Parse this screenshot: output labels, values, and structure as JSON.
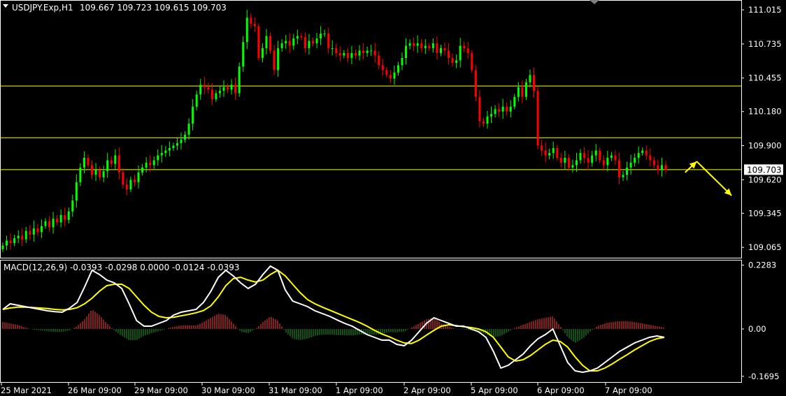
{
  "chart_data": {
    "type": "candlestick",
    "symbol_header": "USDJPY.Exp,H1",
    "ohlc_header": "109.667 109.723 109.615 109.703",
    "last_price": "109.703",
    "price_ticks": [
      "111.015",
      "110.735",
      "110.455",
      "110.180",
      "109.900",
      "109.620",
      "109.345",
      "109.065"
    ],
    "price_range": [
      108.98,
      111.09
    ],
    "horizontal_levels": [
      110.39,
      109.965,
      109.703
    ],
    "time_labels": [
      "25 Mar 2021",
      "26 Mar 09:00",
      "29 Mar 09:00",
      "30 Mar 09:00",
      "31 Mar 09:00",
      "1 Apr 09:00",
      "2 Apr 09:00",
      "5 Apr 09:00",
      "6 Apr 09:00",
      "7 Apr 09:00"
    ],
    "closes": [
      109.08,
      109.12,
      109.1,
      109.14,
      109.16,
      109.13,
      109.2,
      109.17,
      109.22,
      109.19,
      109.24,
      109.28,
      109.23,
      109.3,
      109.27,
      109.33,
      109.29,
      109.36,
      109.45,
      109.6,
      109.72,
      109.8,
      109.74,
      109.66,
      109.7,
      109.64,
      109.69,
      109.78,
      109.75,
      109.82,
      109.68,
      109.58,
      109.54,
      109.62,
      109.6,
      109.68,
      109.72,
      109.76,
      109.74,
      109.78,
      109.82,
      109.84,
      109.86,
      109.88,
      109.9,
      109.92,
      109.95,
      109.99,
      110.08,
      110.22,
      110.32,
      110.4,
      110.38,
      110.36,
      110.28,
      110.33,
      110.35,
      110.38,
      110.36,
      110.4,
      110.33,
      110.55,
      110.75,
      110.95,
      110.9,
      110.88,
      110.62,
      110.7,
      110.8,
      110.68,
      110.52,
      110.7,
      110.74,
      110.76,
      110.72,
      110.78,
      110.8,
      110.79,
      110.7,
      110.76,
      110.74,
      110.78,
      110.82,
      110.82,
      110.7,
      110.7,
      110.66,
      110.64,
      110.66,
      110.62,
      110.66,
      110.64,
      110.68,
      110.66,
      110.68,
      110.68,
      110.64,
      110.56,
      110.52,
      110.48,
      110.45,
      110.5,
      110.56,
      110.62,
      110.72,
      110.74,
      110.72,
      110.74,
      110.7,
      110.72,
      110.7,
      110.74,
      110.66,
      110.7,
      110.68,
      110.62,
      110.58,
      110.6,
      110.72,
      110.7,
      110.66,
      110.52,
      110.3,
      110.1,
      110.08,
      110.14,
      110.16,
      110.2,
      110.18,
      110.22,
      110.18,
      110.22,
      110.3,
      110.38,
      110.3,
      110.42,
      110.48,
      110.35,
      109.9,
      109.86,
      109.82,
      109.84,
      109.88,
      109.8,
      109.76,
      109.8,
      109.72,
      109.74,
      109.78,
      109.84,
      109.8,
      109.76,
      109.82,
      109.86,
      109.78,
      109.74,
      109.8,
      109.82,
      109.78,
      109.64,
      109.66,
      109.72,
      109.76,
      109.8,
      109.84,
      109.86,
      109.82,
      109.78,
      109.74,
      109.7,
      109.74,
      109.7
    ],
    "macd_label": "MACD(12,26,9) -0.0393 -0.0298 0.0000 -0.0124 -0.0393",
    "macd_ticks": [
      "0.2283",
      "0.00",
      "-0.1695"
    ],
    "macd_range": [
      -0.19,
      0.245
    ],
    "macd_line": [
      0.07,
      0.09,
      0.085,
      0.08,
      0.075,
      0.07,
      0.065,
      0.062,
      0.06,
      0.075,
      0.095,
      0.15,
      0.21,
      0.195,
      0.175,
      0.165,
      0.145,
      0.09,
      0.03,
      0.01,
      0.01,
      0.02,
      0.03,
      0.05,
      0.06,
      0.065,
      0.07,
      0.095,
      0.135,
      0.185,
      0.21,
      0.19,
      0.165,
      0.145,
      0.16,
      0.195,
      0.225,
      0.21,
      0.14,
      0.1,
      0.09,
      0.08,
      0.065,
      0.055,
      0.045,
      0.032,
      0.02,
      0.01,
      -0.005,
      -0.02,
      -0.03,
      -0.04,
      -0.04,
      -0.055,
      -0.06,
      -0.04,
      -0.01,
      0.02,
      0.04,
      0.03,
      0.02,
      0.01,
      0.01,
      0.0,
      -0.01,
      -0.03,
      -0.08,
      -0.14,
      -0.13,
      -0.11,
      -0.09,
      -0.06,
      -0.035,
      -0.02,
      0.0,
      -0.06,
      -0.12,
      -0.15,
      -0.155,
      -0.15,
      -0.14,
      -0.12,
      -0.1,
      -0.08,
      -0.065,
      -0.05,
      -0.04,
      -0.03,
      -0.025,
      -0.03
    ],
    "signal_line": [
      0.07,
      0.075,
      0.078,
      0.078,
      0.077,
      0.075,
      0.073,
      0.07,
      0.068,
      0.07,
      0.076,
      0.09,
      0.11,
      0.135,
      0.155,
      0.16,
      0.16,
      0.145,
      0.115,
      0.085,
      0.06,
      0.045,
      0.04,
      0.042,
      0.047,
      0.052,
      0.058,
      0.066,
      0.083,
      0.115,
      0.155,
      0.18,
      0.185,
      0.175,
      0.168,
      0.175,
      0.195,
      0.21,
      0.19,
      0.16,
      0.13,
      0.105,
      0.09,
      0.078,
      0.067,
      0.056,
      0.045,
      0.034,
      0.023,
      0.01,
      -0.005,
      -0.018,
      -0.028,
      -0.04,
      -0.05,
      -0.052,
      -0.04,
      -0.022,
      -0.005,
      0.01,
      0.015,
      0.012,
      0.008,
      0.005,
      0.0,
      -0.01,
      -0.03,
      -0.065,
      -0.1,
      -0.115,
      -0.11,
      -0.095,
      -0.075,
      -0.055,
      -0.04,
      -0.045,
      -0.065,
      -0.1,
      -0.13,
      -0.15,
      -0.15,
      -0.14,
      -0.125,
      -0.108,
      -0.092,
      -0.075,
      -0.06,
      -0.045,
      -0.035,
      -0.03
    ],
    "histogram": [
      0.025,
      0.02,
      0.015,
      0.005,
      -0.002,
      -0.005,
      -0.008,
      -0.01,
      -0.01,
      -0.005,
      0.01,
      0.035,
      0.07,
      0.05,
      0.02,
      -0.005,
      -0.025,
      -0.04,
      -0.04,
      -0.025,
      -0.015,
      -0.008,
      0.0,
      0.008,
      0.013,
      0.013,
      0.012,
      0.025,
      0.04,
      0.055,
      0.05,
      0.02,
      -0.01,
      -0.015,
      0.0,
      0.025,
      0.045,
      0.03,
      -0.01,
      -0.035,
      -0.04,
      -0.035,
      -0.025,
      -0.02,
      -0.02,
      -0.022,
      -0.023,
      -0.024,
      -0.02,
      -0.02,
      -0.02,
      -0.018,
      -0.01,
      -0.012,
      -0.01,
      0.005,
      0.02,
      0.035,
      0.04,
      0.02,
      0.008,
      0.0,
      -0.002,
      -0.005,
      -0.01,
      -0.02,
      -0.03,
      -0.025,
      -0.01,
      0.005,
      0.015,
      0.025,
      0.035,
      0.04,
      0.045,
      0.01,
      -0.03,
      -0.05,
      -0.035,
      -0.01,
      0.01,
      0.02,
      0.025,
      0.028,
      0.028,
      0.025,
      0.02,
      0.015,
      0.01,
      0.005
    ],
    "arrows": [
      {
        "from": [
          176,
          109.68
        ],
        "to": [
          179,
          109.77
        ]
      },
      {
        "from": [
          179,
          109.77
        ],
        "to": [
          188,
          109.49
        ]
      }
    ],
    "colors": {
      "background": "#000000",
      "bull_candle": "#00ff00",
      "bear_candle": "#ff0000",
      "level_line": "#ffff00",
      "macd_line": "#ffffff",
      "signal_line": "#ffff00",
      "hist_positive": "#ff4040",
      "hist_negative": "#20a020",
      "arrow": "#ffff00",
      "axis": "#ffffff"
    }
  }
}
